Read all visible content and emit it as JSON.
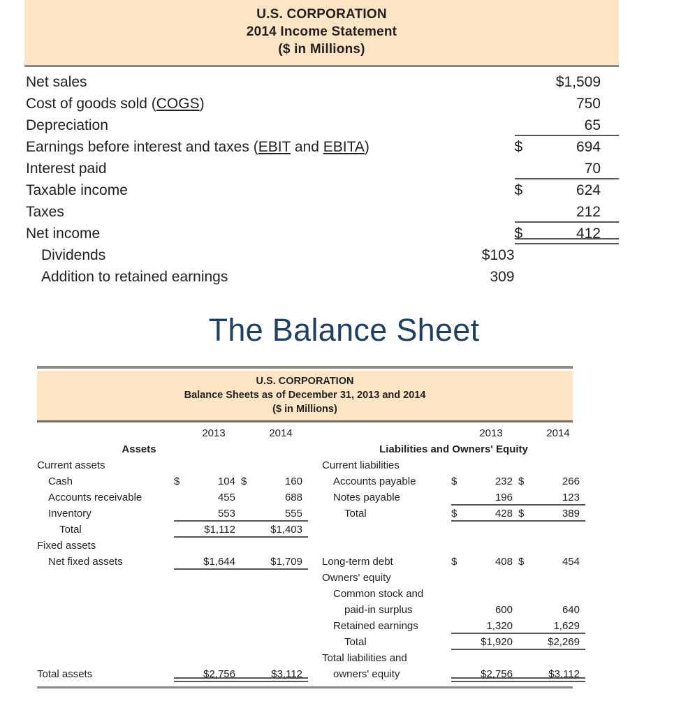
{
  "income_statement": {
    "banner": {
      "company": "U.S. CORPORATION",
      "title": "2014 Income Statement",
      "units": "($ in Millions)"
    },
    "rows": [
      {
        "label": "Net sales",
        "term_prefix": "",
        "terms": [],
        "currency": "$",
        "value": "1,509",
        "mid": "",
        "rule": "none",
        "indent": 0,
        "attached_currency": true
      },
      {
        "label": "Cost of goods sold",
        "term_prefix": " (",
        "terms": [
          "COGS"
        ],
        "term_suffix": ")",
        "currency": "",
        "value": "750",
        "mid": "",
        "rule": "none",
        "indent": 0
      },
      {
        "label": "Depreciation",
        "terms": [],
        "currency": "",
        "value": "65",
        "mid": "",
        "rule": "botline",
        "indent": 0
      },
      {
        "label": "Earnings before interest and taxes",
        "term_prefix": " (",
        "terms": [
          "EBIT",
          "EBITA"
        ],
        "term_joiner": " and ",
        "term_suffix": ")",
        "currency": "$",
        "value": "694",
        "mid": "",
        "rule": "none",
        "indent": 0
      },
      {
        "label": "Interest paid",
        "terms": [],
        "currency": "",
        "value": "70",
        "mid": "",
        "rule": "botline",
        "indent": 0
      },
      {
        "label": "Taxable income",
        "terms": [],
        "currency": "$",
        "value": "624",
        "mid": "",
        "rule": "none",
        "indent": 0
      },
      {
        "label": "Taxes",
        "terms": [],
        "currency": "",
        "value": "212",
        "mid": "",
        "rule": "botline",
        "indent": 0
      },
      {
        "label": "Net income",
        "terms": [],
        "currency": "$",
        "value": "412",
        "mid": "",
        "rule": "dblline",
        "indent": 0
      },
      {
        "label": "Dividends",
        "terms": [],
        "currency": "",
        "value": "",
        "mid": "$103",
        "rule": "none",
        "indent": 1
      },
      {
        "label": "Addition to retained earnings",
        "terms": [],
        "currency": "",
        "value": "",
        "mid": "309",
        "rule": "none",
        "indent": 1
      }
    ]
  },
  "section_heading": "The Balance Sheet",
  "balance_sheet": {
    "banner": {
      "company": "U.S. CORPORATION",
      "title": "Balance Sheets as of December 31, 2013 and 2014",
      "units": "($ in Millions)"
    },
    "year_headers": {
      "left_2013": "2013",
      "left_2014": "2014",
      "right_2013": "2013",
      "right_2014": "2014"
    },
    "section_headers": {
      "left": "Assets",
      "right": "Liabilities and Owners' Equity"
    },
    "rows": [
      {
        "left": {
          "label": "Current assets",
          "indent": 0,
          "c1": "",
          "v1": "",
          "c2": "",
          "v2": "",
          "rule": "none"
        },
        "right": {
          "label": "Current liabilities",
          "indent": 0,
          "c1": "",
          "v1": "",
          "c2": "",
          "v2": "",
          "rule": "none"
        }
      },
      {
        "left": {
          "label": "Cash",
          "indent": 1,
          "c1": "$",
          "v1": "104",
          "c2": "$",
          "v2": "160",
          "rule": "none"
        },
        "right": {
          "label": "Accounts payable",
          "indent": 1,
          "c1": "$",
          "v1": "232",
          "c2": "$",
          "v2": "266",
          "rule": "none"
        }
      },
      {
        "left": {
          "label": "Accounts receivable",
          "indent": 1,
          "c1": "",
          "v1": "455",
          "c2": "",
          "v2": "688",
          "rule": "none"
        },
        "right": {
          "label": "Notes payable",
          "indent": 1,
          "c1": "",
          "v1": "196",
          "c2": "",
          "v2": "123",
          "rule": "underline"
        }
      },
      {
        "left": {
          "label": "Inventory",
          "indent": 1,
          "c1": "",
          "v1": "553",
          "c2": "",
          "v2": "555",
          "rule": "underline"
        },
        "right": {
          "label": "Total",
          "indent": 2,
          "c1": "$",
          "v1": "428",
          "c2": "$",
          "v2": "389",
          "rule": "underline"
        }
      },
      {
        "left": {
          "label": "Total",
          "indent": 2,
          "c1": "",
          "v1": "$1,112",
          "c2": "",
          "v2": "$1,403",
          "rule": "underline"
        },
        "right": {
          "label": "",
          "indent": 0,
          "c1": "",
          "v1": "",
          "c2": "",
          "v2": "",
          "rule": "none"
        }
      },
      {
        "left": {
          "label": "Fixed assets",
          "indent": 0,
          "c1": "",
          "v1": "",
          "c2": "",
          "v2": "",
          "rule": "none"
        },
        "right": {
          "label": "",
          "indent": 0,
          "c1": "",
          "v1": "",
          "c2": "",
          "v2": "",
          "rule": "none"
        }
      },
      {
        "left": {
          "label": "Net fixed assets",
          "indent": 1,
          "c1": "",
          "v1": "$1,644",
          "c2": "",
          "v2": "$1,709",
          "rule": "underline"
        },
        "right": {
          "label": "Long-term debt",
          "indent": 0,
          "c1": "$",
          "v1": "408",
          "c2": "$",
          "v2": "454",
          "rule": "none"
        }
      },
      {
        "left": {
          "label": "",
          "indent": 0,
          "c1": "",
          "v1": "",
          "c2": "",
          "v2": "",
          "rule": "none"
        },
        "right": {
          "label": "Owners' equity",
          "indent": 0,
          "c1": "",
          "v1": "",
          "c2": "",
          "v2": "",
          "rule": "none"
        }
      },
      {
        "left": {
          "label": "",
          "indent": 0,
          "c1": "",
          "v1": "",
          "c2": "",
          "v2": "",
          "rule": "none"
        },
        "right": {
          "label": "Common stock and",
          "indent": 1,
          "c1": "",
          "v1": "",
          "c2": "",
          "v2": "",
          "rule": "none"
        }
      },
      {
        "left": {
          "label": "",
          "indent": 0,
          "c1": "",
          "v1": "",
          "c2": "",
          "v2": "",
          "rule": "none"
        },
        "right": {
          "label": "paid-in surplus",
          "indent": 2,
          "c1": "",
          "v1": "600",
          "c2": "",
          "v2": "640",
          "rule": "none"
        }
      },
      {
        "left": {
          "label": "",
          "indent": 0,
          "c1": "",
          "v1": "",
          "c2": "",
          "v2": "",
          "rule": "none"
        },
        "right": {
          "label": "Retained earnings",
          "indent": 1,
          "c1": "",
          "v1": "1,320",
          "c2": "",
          "v2": "1,629",
          "rule": "underline"
        }
      },
      {
        "left": {
          "label": "",
          "indent": 0,
          "c1": "",
          "v1": "",
          "c2": "",
          "v2": "",
          "rule": "none"
        },
        "right": {
          "label": "Total",
          "indent": 2,
          "c1": "",
          "v1": "$1,920",
          "c2": "",
          "v2": "$2,269",
          "rule": "underline"
        }
      },
      {
        "left": {
          "label": "",
          "indent": 0,
          "c1": "",
          "v1": "",
          "c2": "",
          "v2": "",
          "rule": "none"
        },
        "right": {
          "label": "Total liabilities and",
          "indent": 0,
          "c1": "",
          "v1": "",
          "c2": "",
          "v2": "",
          "rule": "none"
        }
      },
      {
        "left": {
          "label": "Total assets",
          "indent": 0,
          "c1": "",
          "v1": "$2,756",
          "c2": "",
          "v2": "$3,112",
          "rule": "double"
        },
        "right": {
          "label": "owners' equity",
          "indent": 1,
          "c1": "",
          "v1": "$2,756",
          "c2": "",
          "v2": "$3,112",
          "rule": "double"
        }
      }
    ]
  }
}
